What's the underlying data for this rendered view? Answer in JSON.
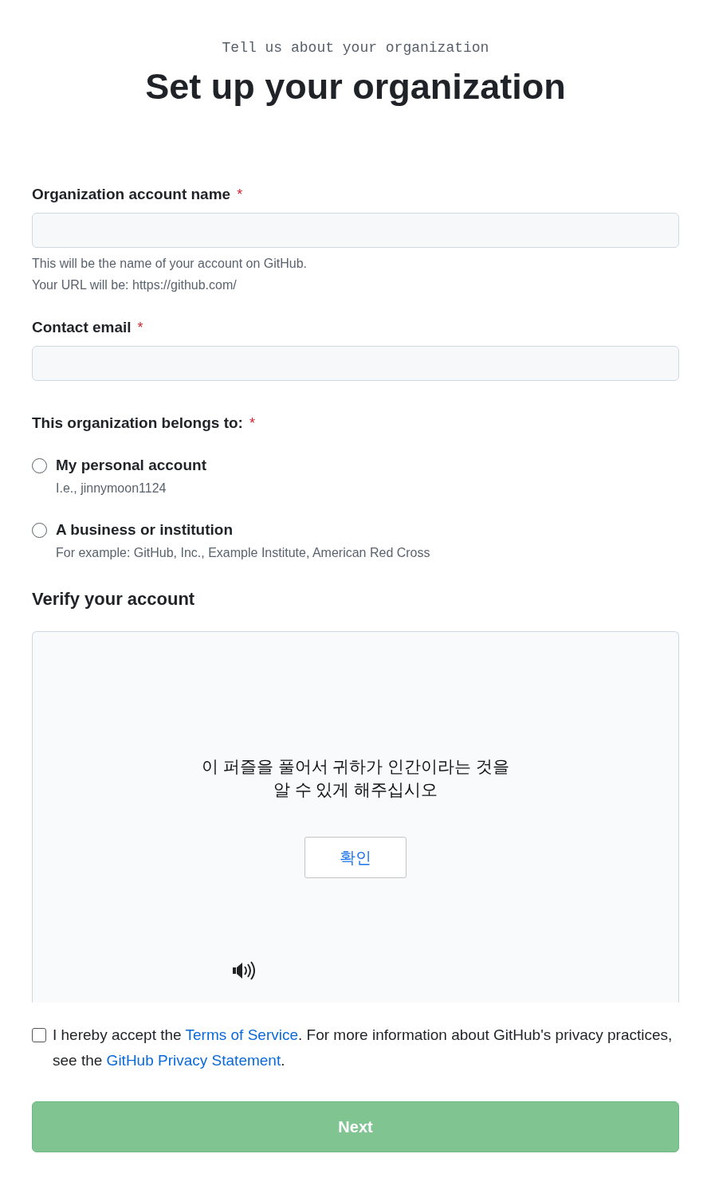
{
  "header": {
    "eyebrow": "Tell us about your organization",
    "title": "Set up your organization"
  },
  "fields": [
    {
      "label": "Organization account name",
      "required_mark": "*",
      "hints": [
        "This will be the name of your account on GitHub.",
        "Your URL will be: https://github.com/"
      ]
    },
    {
      "label": "Contact email",
      "required_mark": "*"
    }
  ],
  "ownership": {
    "label": "This organization belongs to:",
    "required_mark": "*",
    "options": [
      {
        "label": "My personal account",
        "note": "I.e., jinnymoon1124",
        "selected": false
      },
      {
        "label": "A business or institution",
        "note": "For example: GitHub, Inc., Example Institute, American Red Cross",
        "selected": false
      }
    ]
  },
  "verification": {
    "heading": "Verify your account",
    "prompt_lines": [
      "이 퍼즐을 풀어서 귀하가 인간이라는 것을",
      "알 수 있게 해주십시오"
    ],
    "button": "확인"
  },
  "terms": {
    "checked": false,
    "parts": [
      {
        "kind": "text",
        "text": "I hereby accept the "
      },
      {
        "kind": "link",
        "text": "Terms of Service"
      },
      {
        "kind": "text",
        "text": ". For more information about GitHub's privacy practices, see the "
      },
      {
        "kind": "link",
        "text": "GitHub Privacy Statement"
      },
      {
        "kind": "text",
        "text": "."
      }
    ]
  },
  "next_button": {
    "label": "Next",
    "disabled": true
  }
}
